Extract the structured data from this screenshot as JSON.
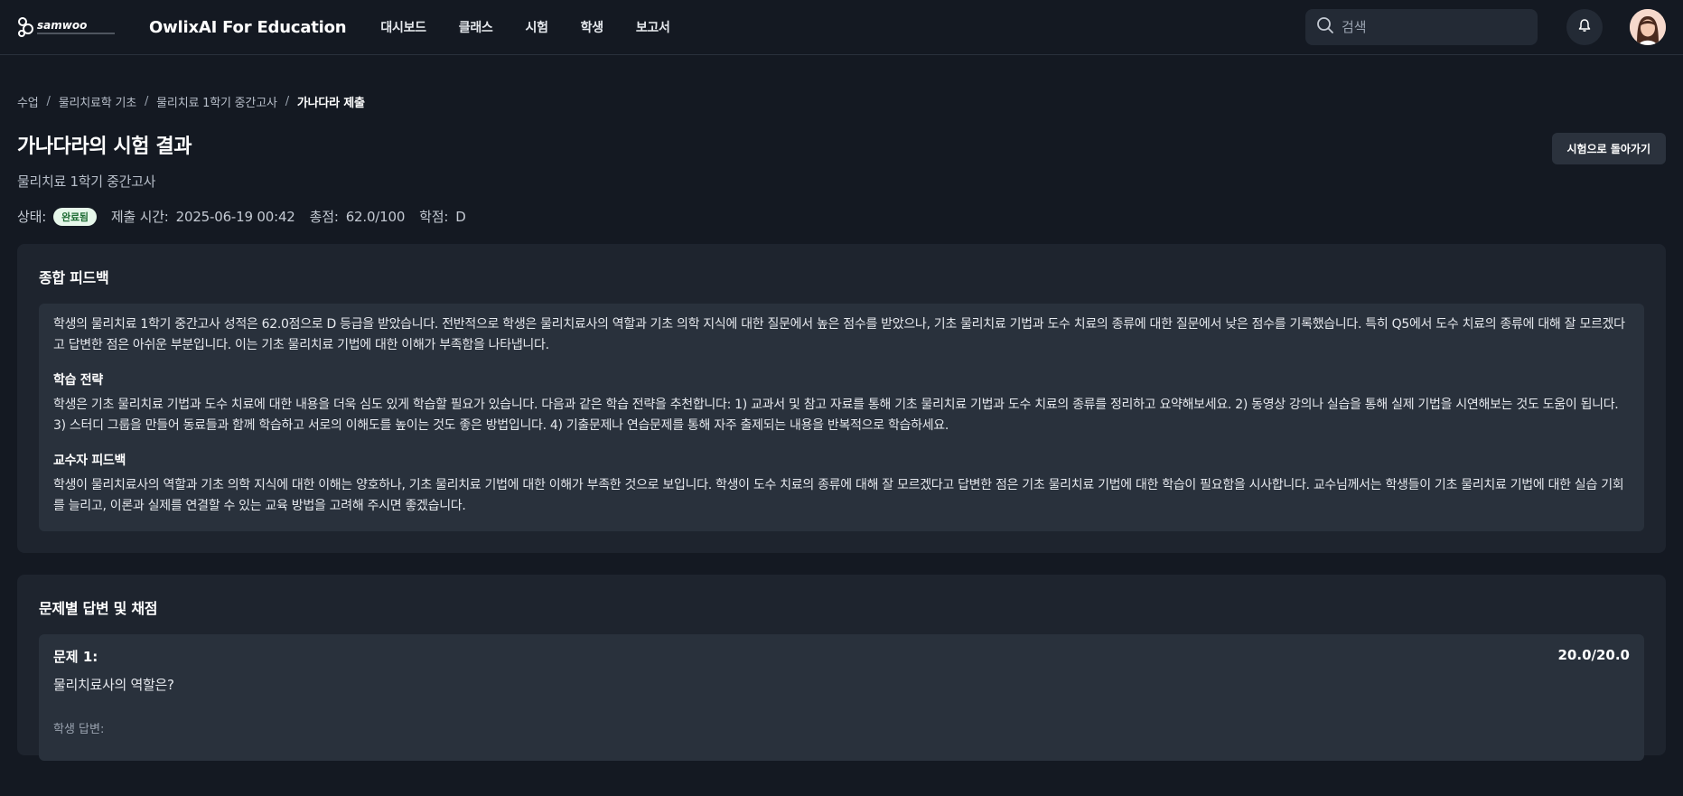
{
  "brand": {
    "logo_text": "samwoo",
    "app_name": "OwlixAI For Education"
  },
  "nav": {
    "items": [
      {
        "label": "대시보드"
      },
      {
        "label": "클래스"
      },
      {
        "label": "시험"
      },
      {
        "label": "학생"
      },
      {
        "label": "보고서"
      }
    ]
  },
  "search": {
    "placeholder": "검색"
  },
  "breadcrumb": {
    "items": [
      "수업",
      "물리치료학 기초",
      "물리치료 1학기 중간고사"
    ],
    "current": "가나다라 제출",
    "separator": "/"
  },
  "header": {
    "title": "가나다라의 시험 결과",
    "subtitle": "물리치료 1학기 중간고사",
    "back_button": "시험으로 돌아가기"
  },
  "meta": {
    "status_label": "상태:",
    "status_value": "완료됨",
    "submit_label": "제출 시간:",
    "submit_value": "2025-06-19 00:42",
    "score_label": "총점:",
    "score_value": "62.0/100",
    "grade_label": "학점:",
    "grade_value": "D"
  },
  "feedback": {
    "title": "종합 피드백",
    "summary": "학생의 물리치료 1학기 중간고사 성적은 62.0점으로 D 등급을 받았습니다. 전반적으로 학생은 물리치료사의 역할과 기초 의학 지식에 대한 질문에서 높은 점수를 받았으나, 기초 물리치료 기법과 도수 치료의 종류에 대한 질문에서 낮은 점수를 기록했습니다. 특히 Q5에서 도수 치료의 종류에 대해 잘 모르겠다고 답변한 점은 아쉬운 부분입니다. 이는 기초 물리치료 기법에 대한 이해가 부족함을 나타냅니다.",
    "strategy_title": "학습 전략",
    "strategy_text": "학생은 기초 물리치료 기법과 도수 치료에 대한 내용을 더욱 심도 있게 학습할 필요가 있습니다. 다음과 같은 학습 전략을 추천합니다: 1) 교과서 및 참고 자료를 통해 기초 물리치료 기법과 도수 치료의 종류를 정리하고 요약해보세요. 2) 동영상 강의나 실습을 통해 실제 기법을 시연해보는 것도 도움이 됩니다. 3) 스터디 그룹을 만들어 동료들과 함께 학습하고 서로의 이해도를 높이는 것도 좋은 방법입니다. 4) 기출문제나 연습문제를 통해 자주 출제되는 내용을 반복적으로 학습하세요.",
    "professor_title": "교수자 피드백",
    "professor_text": "학생이 물리치료사의 역할과 기초 의학 지식에 대한 이해는 양호하나, 기초 물리치료 기법에 대한 이해가 부족한 것으로 보입니다. 학생이 도수 치료의 종류에 대해 잘 모르겠다고 답변한 점은 기초 물리치료 기법에 대한 학습이 필요함을 시사합니다. 교수님께서는 학생들이 기초 물리치료 기법에 대한 실습 기회를 늘리고, 이론과 실제를 연결할 수 있는 교육 방법을 고려해 주시면 좋겠습니다."
  },
  "answers": {
    "title": "문제별 답변 및 채점",
    "questions": [
      {
        "number": "문제 1:",
        "score": "20.0/20.0",
        "question": "물리치료사의 역할은?",
        "answer_label": "학생 답변:"
      }
    ]
  },
  "colors": {
    "background": "#141922",
    "card": "#1e242e",
    "inner": "#29313c",
    "badge_bg": "#e6f7ea",
    "badge_text": "#1d6b33"
  }
}
